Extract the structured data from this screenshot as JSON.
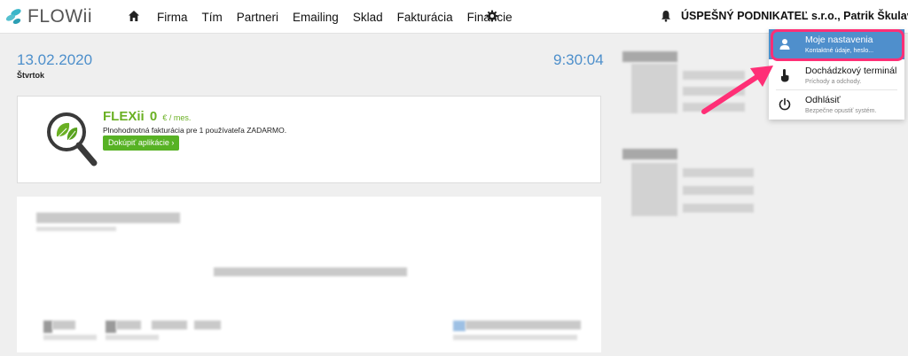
{
  "app": {
    "logo_text": "FLOWii"
  },
  "nav": {
    "items": [
      "Firma",
      "Tím",
      "Partneri",
      "Emailing",
      "Sklad",
      "Fakturácia",
      "Financie"
    ]
  },
  "header": {
    "company_user": "ÚSPEŠNÝ PODNIKATEĽ s.r.o., Patrik Škulavík"
  },
  "dashboard": {
    "date": "13.02.2020",
    "weekday": "Štvrtok",
    "time": "9:30:04"
  },
  "promo": {
    "title": "FLEXii",
    "price": "0",
    "unit": "€ / mes.",
    "description": "Plnohodnotná fakturácia pre 1 používateľa ZADARMO.",
    "button_label": "Dokúpiť aplikácie ›"
  },
  "user_menu": {
    "items": [
      {
        "label": "Moje nastavenia",
        "sub": "Kontaktné údaje, heslo...",
        "icon": "user-icon"
      },
      {
        "label": "Dochádzkový terminál",
        "sub": "Príchody a odchody.",
        "icon": "touch-icon"
      },
      {
        "label": "Odhlásiť",
        "sub": "Bezpečne opustiť systém.",
        "icon": "power-icon"
      }
    ]
  },
  "colors": {
    "accent_blue": "#4f8fcc",
    "promo_green": "#57b224",
    "highlight_pink": "#ff2f76"
  }
}
